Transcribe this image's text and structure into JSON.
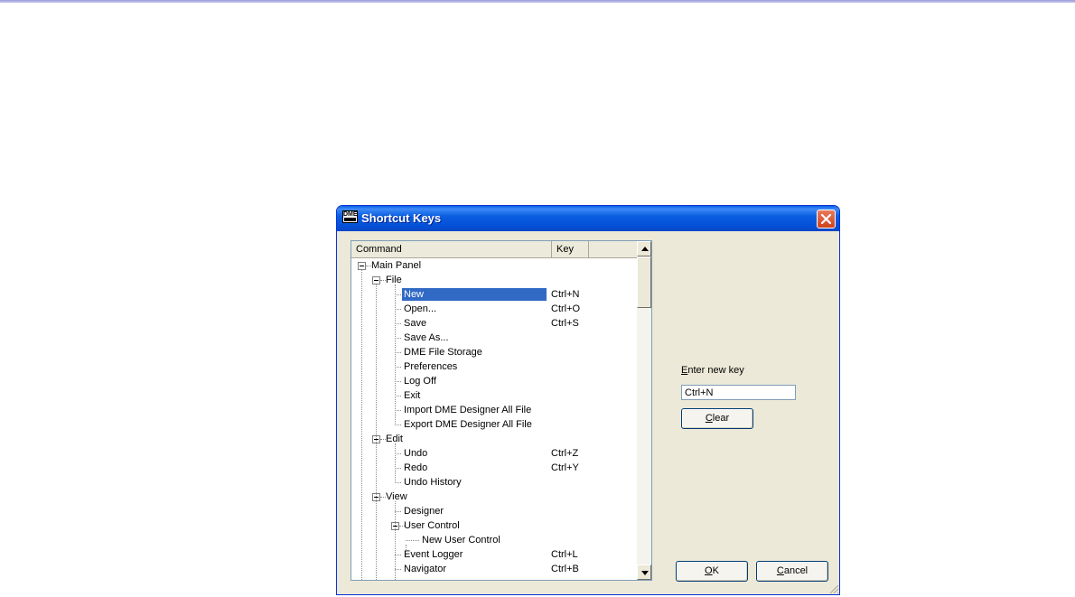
{
  "window": {
    "title": "Shortcut Keys",
    "app_icon_text": "DME"
  },
  "list": {
    "columns": [
      "Command",
      "Key"
    ],
    "rows": [
      {
        "label": "Main Panel",
        "key": "",
        "level": 0,
        "expander": true
      },
      {
        "label": "File",
        "key": "",
        "level": 1,
        "expander": true
      },
      {
        "label": "New",
        "key": "Ctrl+N",
        "level": 2,
        "selected": true
      },
      {
        "label": "Open...",
        "key": "Ctrl+O",
        "level": 2
      },
      {
        "label": "Save",
        "key": "Ctrl+S",
        "level": 2
      },
      {
        "label": "Save As...",
        "key": "",
        "level": 2
      },
      {
        "label": "DME File Storage",
        "key": "",
        "level": 2
      },
      {
        "label": "Preferences",
        "key": "",
        "level": 2
      },
      {
        "label": "Log Off",
        "key": "",
        "level": 2
      },
      {
        "label": "Exit",
        "key": "",
        "level": 2
      },
      {
        "label": "Import DME Designer All File",
        "key": "",
        "level": 2
      },
      {
        "label": "Export DME Designer All File",
        "key": "",
        "level": 2
      },
      {
        "label": "Edit",
        "key": "",
        "level": 1,
        "expander": true
      },
      {
        "label": "Undo",
        "key": "Ctrl+Z",
        "level": 2
      },
      {
        "label": "Redo",
        "key": "Ctrl+Y",
        "level": 2
      },
      {
        "label": "Undo History",
        "key": "",
        "level": 2
      },
      {
        "label": "View",
        "key": "",
        "level": 1,
        "expander": true
      },
      {
        "label": "Designer",
        "key": "",
        "level": 2
      },
      {
        "label": "User Control",
        "key": "",
        "level": 2,
        "expander": true
      },
      {
        "label": "New User Control",
        "key": "",
        "level": 3
      },
      {
        "label": "Event Logger",
        "key": "Ctrl+L",
        "level": 2
      },
      {
        "label": "Navigator",
        "key": "Ctrl+B",
        "level": 2
      }
    ]
  },
  "editor": {
    "label_underlined": "E",
    "label_rest": "nter new key",
    "value": "Ctrl+N",
    "clear_underlined": "C",
    "clear_rest": "lear"
  },
  "buttons": {
    "ok_underlined": "O",
    "ok_rest": "K",
    "cancel_underlined": "C",
    "cancel_rest": "ancel"
  }
}
